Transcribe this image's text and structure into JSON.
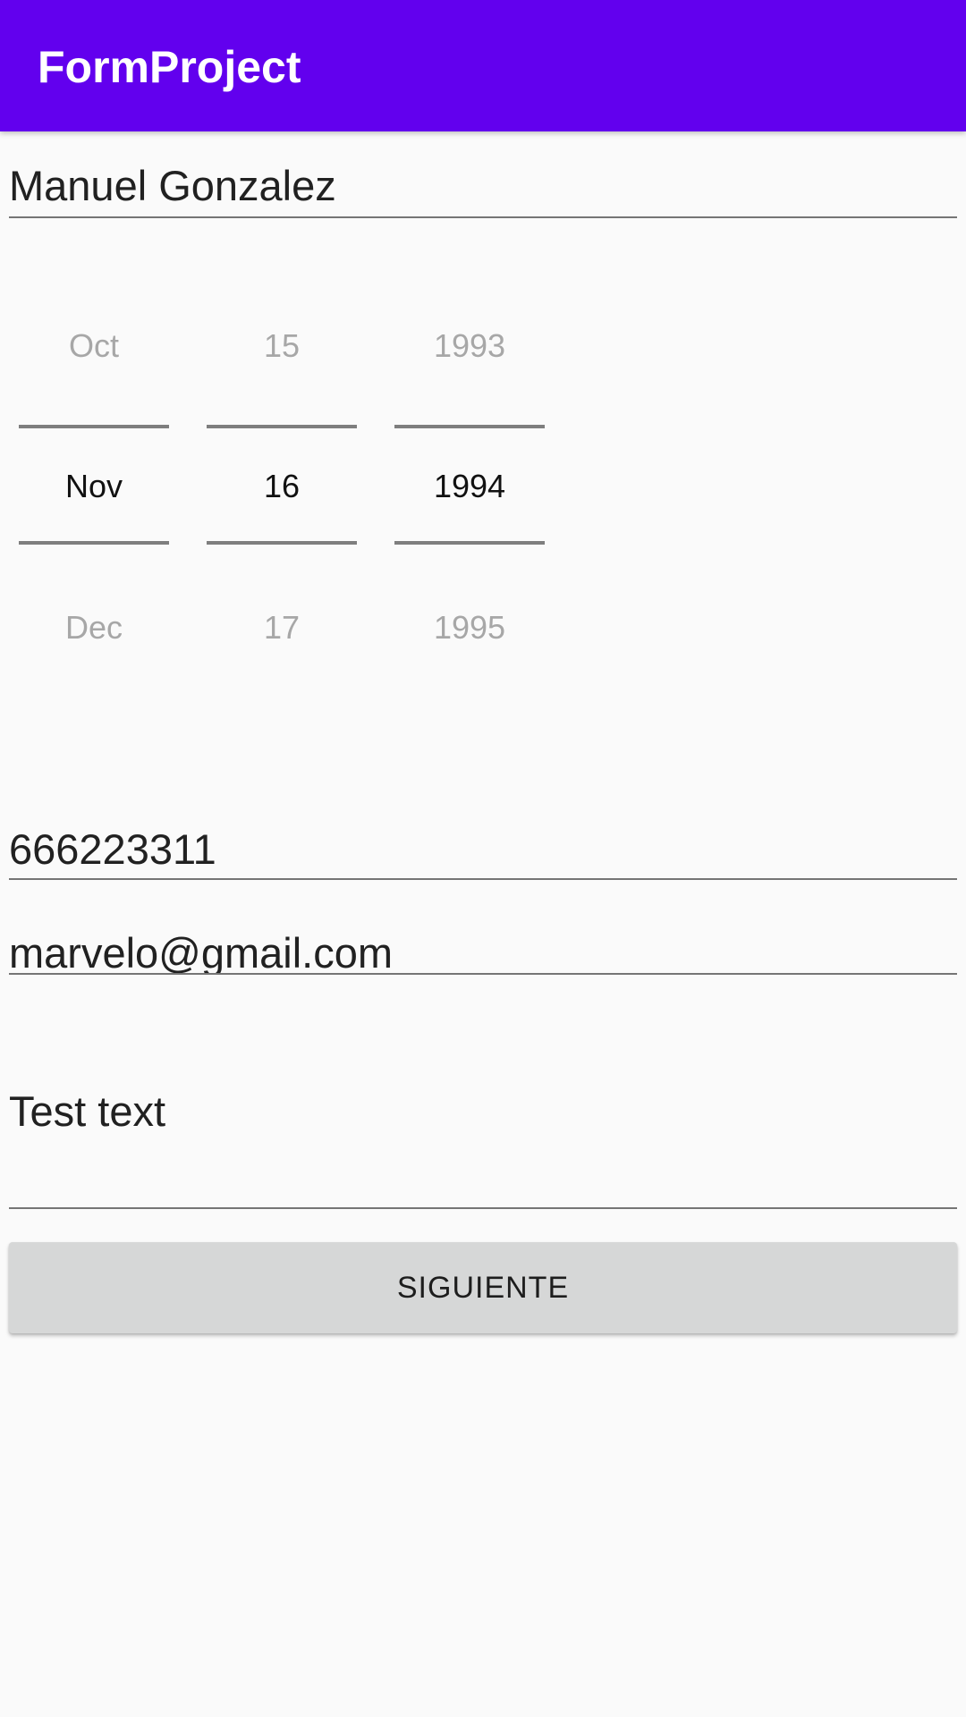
{
  "app_bar": {
    "title": "FormProject",
    "color": "#6200ee"
  },
  "form": {
    "name_value": "Manuel Gonzalez",
    "date_picker": {
      "month": {
        "prev": "Oct",
        "selected": "Nov",
        "next": "Dec"
      },
      "day": {
        "prev": "15",
        "selected": "16",
        "next": "17"
      },
      "year": {
        "prev": "1993",
        "selected": "1994",
        "next": "1995"
      }
    },
    "phone_value": "666223311",
    "email_value": "marvelo@gmail.com",
    "description_value": "Test text",
    "next_button_label": "SIGUIENTE"
  }
}
